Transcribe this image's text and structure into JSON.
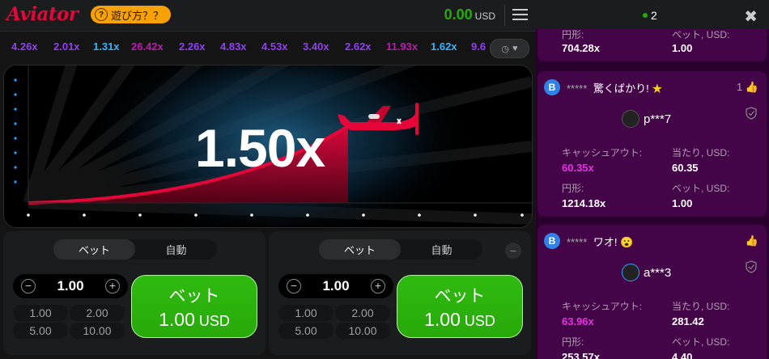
{
  "header": {
    "logo": "Aviator",
    "how_to_play": "遊び方？？",
    "balance": "0.00",
    "currency": "USD"
  },
  "history": {
    "items": [
      {
        "value": "4.26x",
        "color": "#913ef8"
      },
      {
        "value": "2.01x",
        "color": "#913ef8"
      },
      {
        "value": "1.31x",
        "color": "#34b4ff"
      },
      {
        "value": "26.42x",
        "color": "#c017b4"
      },
      {
        "value": "2.26x",
        "color": "#913ef8"
      },
      {
        "value": "4.83x",
        "color": "#913ef8"
      },
      {
        "value": "4.53x",
        "color": "#913ef8"
      },
      {
        "value": "3.40x",
        "color": "#913ef8"
      },
      {
        "value": "2.62x",
        "color": "#913ef8"
      },
      {
        "value": "11.93x",
        "color": "#c017b4"
      },
      {
        "value": "1.62x",
        "color": "#34b4ff"
      },
      {
        "value": "9.6",
        "color": "#913ef8"
      }
    ]
  },
  "game": {
    "multiplier": "1.50x",
    "accent": "#e50539"
  },
  "bet_panels": [
    {
      "tab_bet": "ベット",
      "tab_auto": "自動",
      "stake": "1.00",
      "quick": [
        "1.00",
        "2.00",
        "5.00",
        "10.00"
      ],
      "button_label": "ベット",
      "button_amount": "1.00",
      "button_currency": "USD"
    },
    {
      "tab_bet": "ベット",
      "tab_auto": "自動",
      "stake": "1.00",
      "quick": [
        "1.00",
        "2.00",
        "5.00",
        "10.00"
      ],
      "button_label": "ベット",
      "button_amount": "1.00",
      "button_currency": "USD",
      "remove_symbol": "−"
    }
  ],
  "sidebar": {
    "online_count": "2",
    "top_partial": {
      "left_label": "円形:",
      "left_value": "704.28x",
      "right_label": "ベット, USD:",
      "right_value": "1.00"
    },
    "cards": [
      {
        "badge": "B",
        "masked_name": "*****",
        "message": "驚くばかり!",
        "emoji": "★",
        "likes": "1",
        "player": "p***7",
        "cashout_label": "キャッシュアウト:",
        "cashout_value": "60.35x",
        "win_label": "当たり, USD:",
        "win_value": "60.35",
        "round_label": "円形:",
        "round_value": "1214.18x",
        "bet_label": "ベット, USD:",
        "bet_value": "1.00"
      },
      {
        "badge": "B",
        "masked_name": "*****",
        "message": "ワオ!",
        "emoji": "😮",
        "player": "a***3",
        "cashout_label": "キャッシュアウト:",
        "cashout_value": "63.96x",
        "win_label": "当たり, USD:",
        "win_value": "281.42",
        "round_label": "円形:",
        "round_value": "253.57x",
        "bet_label": "ベット, USD:",
        "bet_value": "4.40"
      }
    ]
  }
}
